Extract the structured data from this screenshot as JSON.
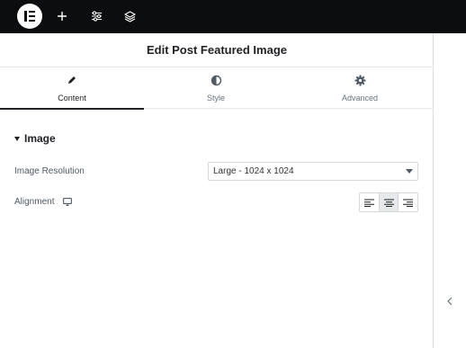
{
  "topbar": {
    "logo_icon": "elementor-logo-icon",
    "buttons": [
      {
        "icon": "plus-icon"
      },
      {
        "icon": "sliders-icon"
      },
      {
        "icon": "layers-icon"
      }
    ]
  },
  "panel": {
    "title": "Edit Post Featured Image",
    "tabs": [
      {
        "label": "Content",
        "icon": "pencil-icon",
        "active": true
      },
      {
        "label": "Style",
        "icon": "half-circle-icon",
        "active": false
      },
      {
        "label": "Advanced",
        "icon": "gear-icon",
        "active": false
      }
    ],
    "section": {
      "label": "Image",
      "expanded": true
    },
    "controls": {
      "resolution": {
        "label": "Image Resolution",
        "value": "Large - 1024 x 1024"
      },
      "alignment": {
        "label": "Alignment",
        "device_icon": "desktop-icon",
        "options": [
          "left",
          "center",
          "right"
        ],
        "selected": "center"
      }
    }
  },
  "colors": {
    "topbar": "#0c0d0e",
    "active_tab": "#1f2124",
    "text_muted": "#69727d"
  }
}
